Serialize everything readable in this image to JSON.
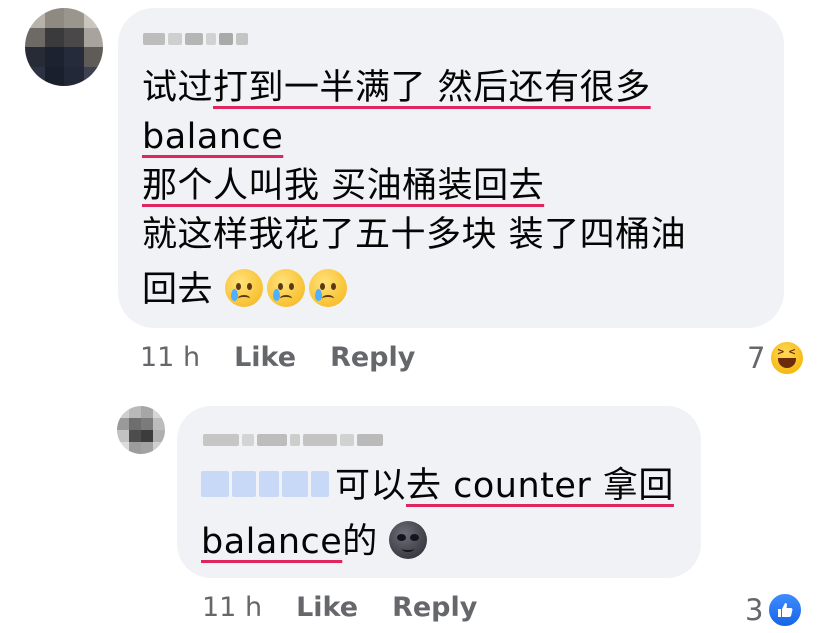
{
  "comments": [
    {
      "author_blurred": true,
      "lines": [
        {
          "parts": [
            {
              "text": "试过",
              "underline": false
            },
            {
              "text": "打到一半满了 然后还有很多",
              "underline": true
            }
          ]
        },
        {
          "parts": [
            {
              "text": "balance",
              "underline": true
            }
          ]
        },
        {
          "parts": [
            {
              "text": "那个人叫我 买油桶装回去",
              "underline": true
            }
          ]
        },
        {
          "parts": [
            {
              "text": "就这样我花了五十多块 装了四桶油",
              "underline": false
            }
          ]
        },
        {
          "parts": [
            {
              "text": "回去 ",
              "underline": false
            }
          ]
        }
      ],
      "emojis": [
        "face-holding-back-tears",
        "face-holding-back-tears",
        "face-holding-back-tears"
      ],
      "time": "11 h",
      "like_label": "Like",
      "reply_label": "Reply",
      "reaction_count": "7",
      "reaction_icon": "haha-reaction-icon"
    },
    {
      "author_blurred": true,
      "mention_blurred": true,
      "line1": {
        "plain": "可以",
        "underlined": "去 counter 拿回"
      },
      "line2": {
        "underlined": "balance",
        "plain": "的"
      },
      "emoji": "new-moon-face",
      "time": "11 h",
      "like_label": "Like",
      "reply_label": "Reply",
      "reaction_count": "3",
      "reaction_icon": "like-reaction-icon"
    }
  ],
  "colors": {
    "bubble": "#f0f2f5",
    "underline": "#e0245e",
    "meta": "#65676b",
    "text": "#050505",
    "like_blue": "#1877f2"
  }
}
